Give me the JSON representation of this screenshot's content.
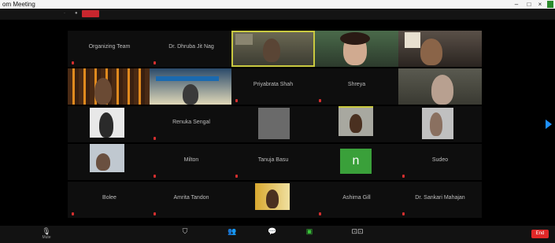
{
  "window": {
    "title": "om Meeting",
    "min": "–",
    "max": "□",
    "close": "×"
  },
  "topbar": {
    "left_text": "",
    "rec_label": "",
    "view_label": ""
  },
  "participants": [
    {
      "name": "Organizing Team",
      "video": false
    },
    {
      "name": "Dr. Dhruba Jit Nag",
      "video": false
    },
    {
      "name": "",
      "video": true,
      "highlight": true
    },
    {
      "name": "",
      "video": true
    },
    {
      "name": "",
      "video": true
    },
    {
      "name": "",
      "video": true
    },
    {
      "name": "",
      "video": true
    },
    {
      "name": "Priyabrata Shah",
      "video": false
    },
    {
      "name": "Shreya",
      "video": false
    },
    {
      "name": "",
      "video": true
    },
    {
      "name": "",
      "video": true
    },
    {
      "name": "Renuka Sengal",
      "video": false
    },
    {
      "name": "",
      "video": true
    },
    {
      "name": "",
      "video": true
    },
    {
      "name": "",
      "video": true
    },
    {
      "name": "",
      "video": true
    },
    {
      "name": "Milton",
      "video": false
    },
    {
      "name": "Tanuja Basu",
      "video": false
    },
    {
      "name": "n",
      "video": false,
      "avatar": true
    },
    {
      "name": "Sudeo",
      "video": false
    },
    {
      "name": "Bolee",
      "video": false
    },
    {
      "name": "Amrita Tandon",
      "video": false
    },
    {
      "name": "",
      "video": true
    },
    {
      "name": "Ashima Gill",
      "video": false
    },
    {
      "name": "Dr. Sankari Mahajan",
      "video": false
    }
  ],
  "toolbar": {
    "mute": "Mute",
    "video": "",
    "security": "",
    "participants_count": "",
    "participants": "",
    "chat": "",
    "share": "",
    "record": "",
    "reactions": "",
    "end": "End",
    "mute_icon": "microphone-icon",
    "video_icon": "camera-icon",
    "share_icon": "share-screen-icon"
  }
}
